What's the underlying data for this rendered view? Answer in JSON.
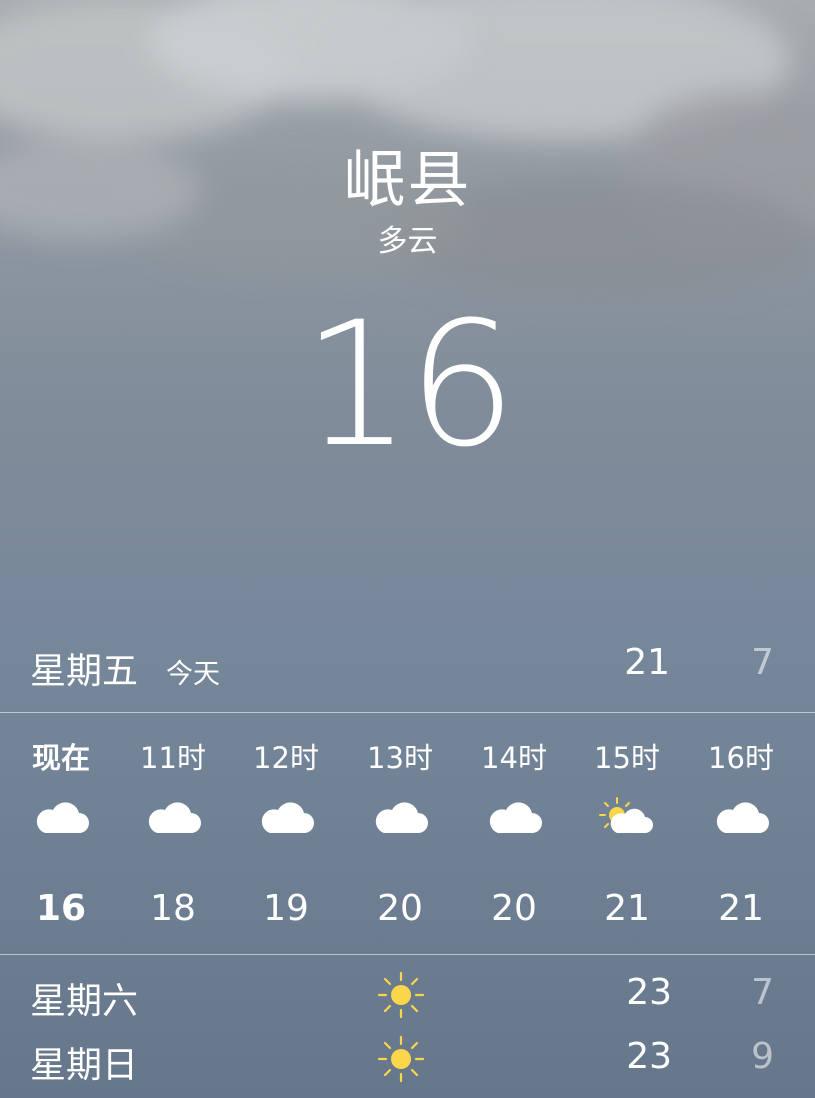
{
  "location": {
    "city": "岷县",
    "condition": "多云",
    "temperature": "16"
  },
  "today": {
    "day": "星期五",
    "tag": "今天",
    "high": "21",
    "low": "7"
  },
  "hourly": [
    {
      "label": "现在",
      "icon": "cloud-icon",
      "temp": "16"
    },
    {
      "label": "11时",
      "icon": "cloud-icon",
      "temp": "18"
    },
    {
      "label": "12时",
      "icon": "cloud-icon",
      "temp": "19"
    },
    {
      "label": "13时",
      "icon": "cloud-icon",
      "temp": "20"
    },
    {
      "label": "14时",
      "icon": "cloud-icon",
      "temp": "20"
    },
    {
      "label": "15时",
      "icon": "partly-sunny-icon",
      "temp": "21"
    },
    {
      "label": "16时",
      "icon": "cloud-icon",
      "temp": "21"
    }
  ],
  "daily": [
    {
      "day": "星期六",
      "icon": "sun-icon",
      "high": "23",
      "low": "7"
    },
    {
      "day": "星期日",
      "icon": "sun-icon",
      "high": "23",
      "low": "9"
    }
  ],
  "colors": {
    "sun": "#f9d64a",
    "low_temp": "rgba(255,255,255,0.55)"
  }
}
